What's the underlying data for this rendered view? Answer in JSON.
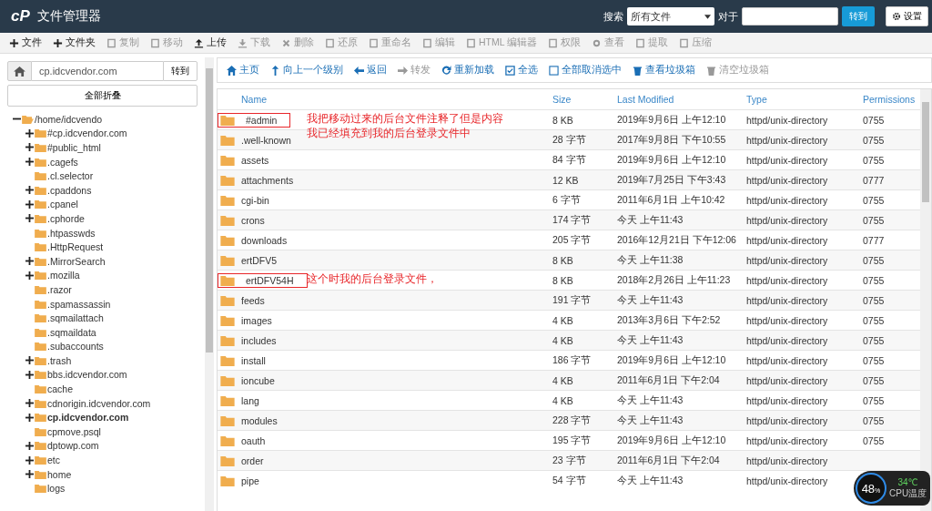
{
  "header": {
    "logo": "cP",
    "title": "文件管理器",
    "search_label": "搜索",
    "search_scope": "所有文件",
    "for_label": "对于",
    "go": "转到",
    "settings": "设置"
  },
  "toolbar": [
    {
      "label": "文件",
      "disabled": false
    },
    {
      "label": "文件夹",
      "disabled": false
    },
    {
      "label": "复制",
      "disabled": true
    },
    {
      "label": "移动",
      "disabled": true
    },
    {
      "label": "上传",
      "disabled": false
    },
    {
      "label": "下载",
      "disabled": true
    },
    {
      "label": "删除",
      "disabled": true
    },
    {
      "label": "还原",
      "disabled": true
    },
    {
      "label": "重命名",
      "disabled": true
    },
    {
      "label": "编辑",
      "disabled": true
    },
    {
      "label": "HTML 编辑器",
      "disabled": true
    },
    {
      "label": "权限",
      "disabled": true
    },
    {
      "label": "查看",
      "disabled": true
    },
    {
      "label": "提取",
      "disabled": true
    },
    {
      "label": "压缩",
      "disabled": true
    }
  ],
  "sidebar": {
    "path": "cp.idcvendor.com",
    "go": "转到",
    "collapse_all": "全部折叠",
    "tree": [
      {
        "label": "/home/idcvendo",
        "expanded": true,
        "current": false,
        "children": [
          {
            "label": "#cp.idcvendor.com",
            "expanded": false,
            "current": false
          },
          {
            "label": "#public_html",
            "expanded": false,
            "current": false
          },
          {
            "label": ".cagefs",
            "expanded": false,
            "current": false
          },
          {
            "label": ".cl.selector",
            "current": false
          },
          {
            "label": ".cpaddons",
            "expanded": false,
            "current": false
          },
          {
            "label": ".cpanel",
            "expanded": false,
            "current": false
          },
          {
            "label": ".cphorde",
            "expanded": false,
            "current": false
          },
          {
            "label": ".htpasswds",
            "current": false
          },
          {
            "label": ".HttpRequest",
            "current": false
          },
          {
            "label": ".MirrorSearch",
            "expanded": false,
            "current": false
          },
          {
            "label": ".mozilla",
            "expanded": false,
            "current": false
          },
          {
            "label": ".razor",
            "current": false
          },
          {
            "label": ".spamassassin",
            "current": false
          },
          {
            "label": ".sqmailattach",
            "current": false
          },
          {
            "label": ".sqmaildata",
            "current": false
          },
          {
            "label": ".subaccounts",
            "current": false
          },
          {
            "label": ".trash",
            "expanded": false,
            "current": false
          },
          {
            "label": "bbs.idcvendor.com",
            "expanded": false,
            "current": false
          },
          {
            "label": "cache",
            "current": false
          },
          {
            "label": "cdnorigin.idcvendor.com",
            "expanded": false,
            "current": false
          },
          {
            "label": "cp.idcvendor.com",
            "expanded": false,
            "current": true
          },
          {
            "label": "cpmove.psql",
            "current": false
          },
          {
            "label": "dptowp.com",
            "expanded": false,
            "current": false
          },
          {
            "label": "etc",
            "expanded": false,
            "current": false
          },
          {
            "label": "home",
            "expanded": false,
            "current": false
          },
          {
            "label": "logs",
            "current": false
          }
        ]
      }
    ]
  },
  "nav": [
    {
      "label": "主页",
      "disabled": false
    },
    {
      "label": "向上一个级别",
      "disabled": false
    },
    {
      "label": "返回",
      "disabled": false
    },
    {
      "label": "转发",
      "disabled": true
    },
    {
      "label": "重新加载",
      "disabled": false
    },
    {
      "label": "全选",
      "disabled": false
    },
    {
      "label": "全部取消选中",
      "disabled": false
    },
    {
      "label": "查看垃圾箱",
      "disabled": false
    },
    {
      "label": "清空垃圾箱",
      "disabled": true
    }
  ],
  "table": {
    "columns": [
      "Name",
      "Size",
      "Last Modified",
      "Type",
      "Permissions"
    ],
    "rows": [
      {
        "name": "#admin",
        "size": "8 KB",
        "modified": "2019年9月6日 上午12:10",
        "type": "httpd/unix-directory",
        "perms": "0755",
        "boxed": true,
        "annotation": [
          "我把移动过来的后台文件注释了但是内容",
          "我已经填充到我的后台登录文件中"
        ]
      },
      {
        "name": ".well-known",
        "size": "28 字节",
        "modified": "2017年9月8日 下午10:55",
        "type": "httpd/unix-directory",
        "perms": "0755",
        "boxed": false
      },
      {
        "name": "assets",
        "size": "84 字节",
        "modified": "2019年9月6日 上午12:10",
        "type": "httpd/unix-directory",
        "perms": "0755",
        "boxed": false
      },
      {
        "name": "attachments",
        "size": "12 KB",
        "modified": "2019年7月25日 下午3:43",
        "type": "httpd/unix-directory",
        "perms": "0777",
        "boxed": false
      },
      {
        "name": "cgi-bin",
        "size": "6 字节",
        "modified": "2011年6月1日 上午10:42",
        "type": "httpd/unix-directory",
        "perms": "0755",
        "boxed": false
      },
      {
        "name": "crons",
        "size": "174 字节",
        "modified": "今天 上午11:43",
        "type": "httpd/unix-directory",
        "perms": "0755",
        "boxed": false
      },
      {
        "name": "downloads",
        "size": "205 字节",
        "modified": "2016年12月21日 下午12:06",
        "type": "httpd/unix-directory",
        "perms": "0777",
        "boxed": false
      },
      {
        "name": "ertDFV5",
        "size": "8 KB",
        "modified": "今天 上午11:38",
        "type": "httpd/unix-directory",
        "perms": "0755",
        "boxed": false
      },
      {
        "name": "ertDFV54H",
        "size": "8 KB",
        "modified": "2018年2月26日 上午11:23",
        "type": "httpd/unix-directory",
        "perms": "0755",
        "boxed": true,
        "annotation": [
          "这个时我的后台登录文件，"
        ]
      },
      {
        "name": "feeds",
        "size": "191 字节",
        "modified": "今天 上午11:43",
        "type": "httpd/unix-directory",
        "perms": "0755",
        "boxed": false
      },
      {
        "name": "images",
        "size": "4 KB",
        "modified": "2013年3月6日 下午2:52",
        "type": "httpd/unix-directory",
        "perms": "0755",
        "boxed": false
      },
      {
        "name": "includes",
        "size": "4 KB",
        "modified": "今天 上午11:43",
        "type": "httpd/unix-directory",
        "perms": "0755",
        "boxed": false
      },
      {
        "name": "install",
        "size": "186 字节",
        "modified": "2019年9月6日 上午12:10",
        "type": "httpd/unix-directory",
        "perms": "0755",
        "boxed": false
      },
      {
        "name": "ioncube",
        "size": "4 KB",
        "modified": "2011年6月1日 下午2:04",
        "type": "httpd/unix-directory",
        "perms": "0755",
        "boxed": false
      },
      {
        "name": "lang",
        "size": "4 KB",
        "modified": "今天 上午11:43",
        "type": "httpd/unix-directory",
        "perms": "0755",
        "boxed": false
      },
      {
        "name": "modules",
        "size": "228 字节",
        "modified": "今天 上午11:43",
        "type": "httpd/unix-directory",
        "perms": "0755",
        "boxed": false
      },
      {
        "name": "oauth",
        "size": "195 字节",
        "modified": "2019年9月6日 上午12:10",
        "type": "httpd/unix-directory",
        "perms": "0755",
        "boxed": false
      },
      {
        "name": "order",
        "size": "23 字节",
        "modified": "2011年6月1日 下午2:04",
        "type": "httpd/unix-directory",
        "boxed": false
      },
      {
        "name": "pipe",
        "size": "54 字节",
        "modified": "今天 上午11:43",
        "type": "httpd/unix-directory",
        "boxed": false
      }
    ]
  },
  "cpu_widget": {
    "percent": "48",
    "unit": "%",
    "temp": "34℃",
    "label": "CPU温度"
  }
}
